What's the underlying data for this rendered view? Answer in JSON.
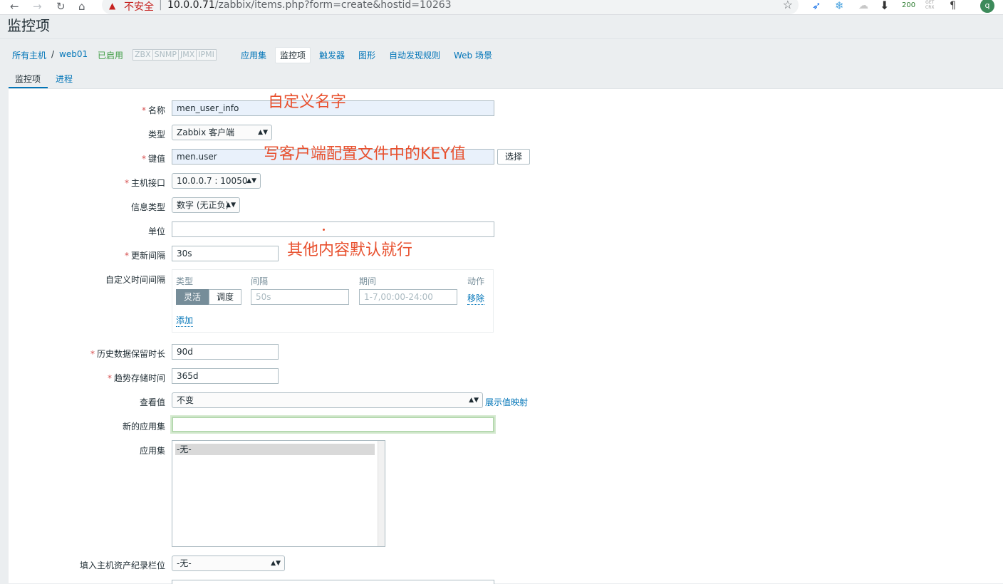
{
  "browser": {
    "back": "←",
    "forward": "→",
    "reload": "↻",
    "home": "⌂",
    "security_label": "不安全",
    "url_host": "10.0.0.71",
    "url_path": "/zabbix/items.php?form=create&hostid=10263",
    "ext_counter": "200",
    "ext_get": "GET",
    "ext_crx": "CRX",
    "avatar_letter": "q"
  },
  "page": {
    "title": "监控项"
  },
  "breadcrumb": {
    "all_hosts": "所有主机",
    "separator": "/",
    "host": "web01",
    "status": "已启用",
    "protocols": [
      "ZBX",
      "SNMP",
      "JMX",
      "IPMI"
    ],
    "nav": [
      "应用集",
      "监控项",
      "触发器",
      "图形",
      "自动发现规则",
      "Web 场景"
    ],
    "active_nav": "监控项"
  },
  "tabs": [
    "监控项",
    "进程"
  ],
  "form": {
    "name_label": "名称",
    "name_value": "men_user_info",
    "type_label": "类型",
    "type_value": "Zabbix 客户端",
    "key_label": "键值",
    "key_value": "men.user",
    "key_select_button": "选择",
    "interface_label": "主机接口",
    "interface_value": "10.0.0.7 : 10050",
    "info_type_label": "信息类型",
    "info_type_value": "数字 (无正负)",
    "units_label": "单位",
    "units_value": "",
    "update_label": "更新间隔",
    "update_value": "30s",
    "custom_label": "自定义时间间隔",
    "custom": {
      "col_type": "类型",
      "col_interval": "间隔",
      "col_period": "期间",
      "col_action": "动作",
      "flexible": "灵活",
      "scheduling": "调度",
      "interval_placeholder": "50s",
      "period_placeholder": "1-7,00:00-24:00",
      "remove": "移除",
      "add": "添加"
    },
    "history_label": "历史数据保留时长",
    "history_value": "90d",
    "trends_label": "趋势存储时间",
    "trends_value": "365d",
    "valuemap_label": "查看值",
    "valuemap_value": "不变",
    "valuemap_link": "展示值映射",
    "new_app_label": "新的应用集",
    "new_app_value": "",
    "apps_label": "应用集",
    "apps_options": [
      "-无-"
    ],
    "inventory_label": "填入主机资产纪录栏位",
    "inventory_value": "-无-"
  },
  "annotations": {
    "name_note": "自定义名字",
    "key_note": "写客户端配置文件中的KEY值",
    "other_note": "其他内容默认就行"
  },
  "colors": {
    "annotation": "#e8502e",
    "link": "#0275b8",
    "enabled": "#429e47",
    "required": "#d64e4e"
  }
}
